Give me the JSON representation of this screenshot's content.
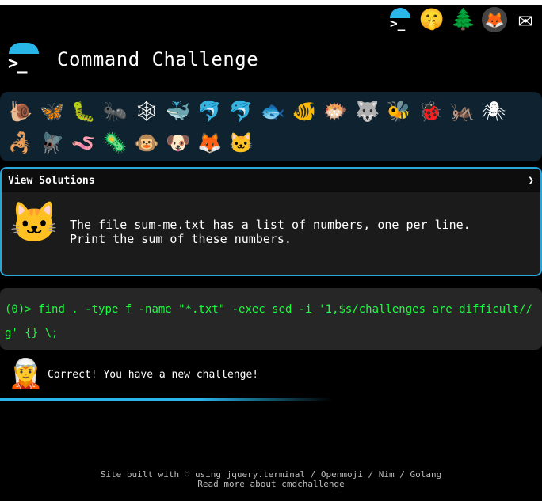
{
  "top_icons": [
    {
      "name": "terminal",
      "glyph": ">_"
    },
    {
      "name": "shushing-face",
      "glyph": "🤫"
    },
    {
      "name": "evergreen-tree",
      "glyph": "🌲"
    },
    {
      "name": "gitlab",
      "glyph": "🦊"
    },
    {
      "name": "envelope",
      "glyph": "✉"
    }
  ],
  "header": {
    "logo_prompt": ">_",
    "title": "Command Challenge"
  },
  "emojis": [
    "🐌",
    "🦋",
    "🐛",
    "🐜",
    "🕸",
    "🐳",
    "🐬",
    "🐬",
    "🐟",
    "🐠",
    "🐡",
    "🐺",
    "🐝",
    "🐞",
    "🦗",
    "🕷",
    "🦂",
    "🪰",
    "🪱",
    "🦠",
    "🐵",
    "🐶",
    "🦊",
    "🐱"
  ],
  "challenge": {
    "header_label": "View Solutions",
    "chevron": "❯",
    "cat_glyph": "🐱",
    "text": "The file sum-me.txt has a list of numbers, one per line.\nPrint the sum of these numbers."
  },
  "terminal": {
    "prompt": "(0)> ",
    "command": "find . -type f -name \"*.txt\" -exec sed -i '1,$s/challenges are difficult//g' {} \\;"
  },
  "result": {
    "glyph": "🧝",
    "message": "Correct! You have a new challenge!"
  },
  "footer": {
    "line1_prefix": "Site built with ♡ using ",
    "jquery_terminal": "jquery.terminal",
    "sep1": " / ",
    "openmoji": "Openmoji",
    "sep2": " / ",
    "nim": "Nim",
    "sep3": " / ",
    "golang": "Golang",
    "line2_prefix": "Read more about ",
    "cmdchallenge": "cmdchallenge"
  },
  "colors": {
    "accent": "#29b6e8",
    "terminal_text": "#1aff3d",
    "panel_bg": "#0f2230"
  }
}
